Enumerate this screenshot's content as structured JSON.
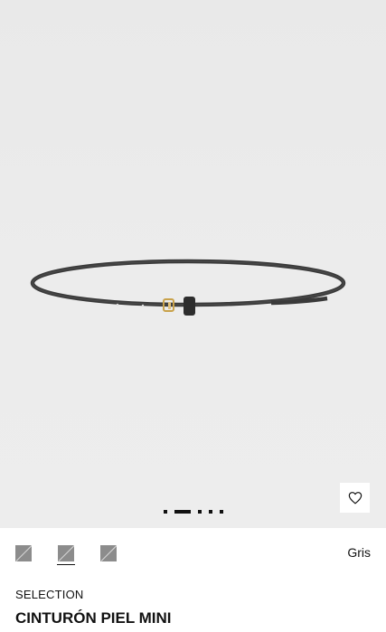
{
  "product": {
    "collection": "SELECTION",
    "title": "CINTURÓN PIEL MINI",
    "selected_color": "Gris"
  },
  "gallery": {
    "image_icon": "belt-product-photo",
    "slide_count": 5,
    "active_slide": 2,
    "background_color": "#ebebeb"
  },
  "wishlist": {
    "icon": "heart-outline-icon"
  },
  "swatches": [
    {
      "icon": "color-swatch",
      "color": "#8c8c8c",
      "selected": false
    },
    {
      "icon": "color-swatch",
      "color": "#8c8c8c",
      "selected": true
    },
    {
      "icon": "color-swatch",
      "color": "#8c8c8c",
      "selected": false
    }
  ]
}
